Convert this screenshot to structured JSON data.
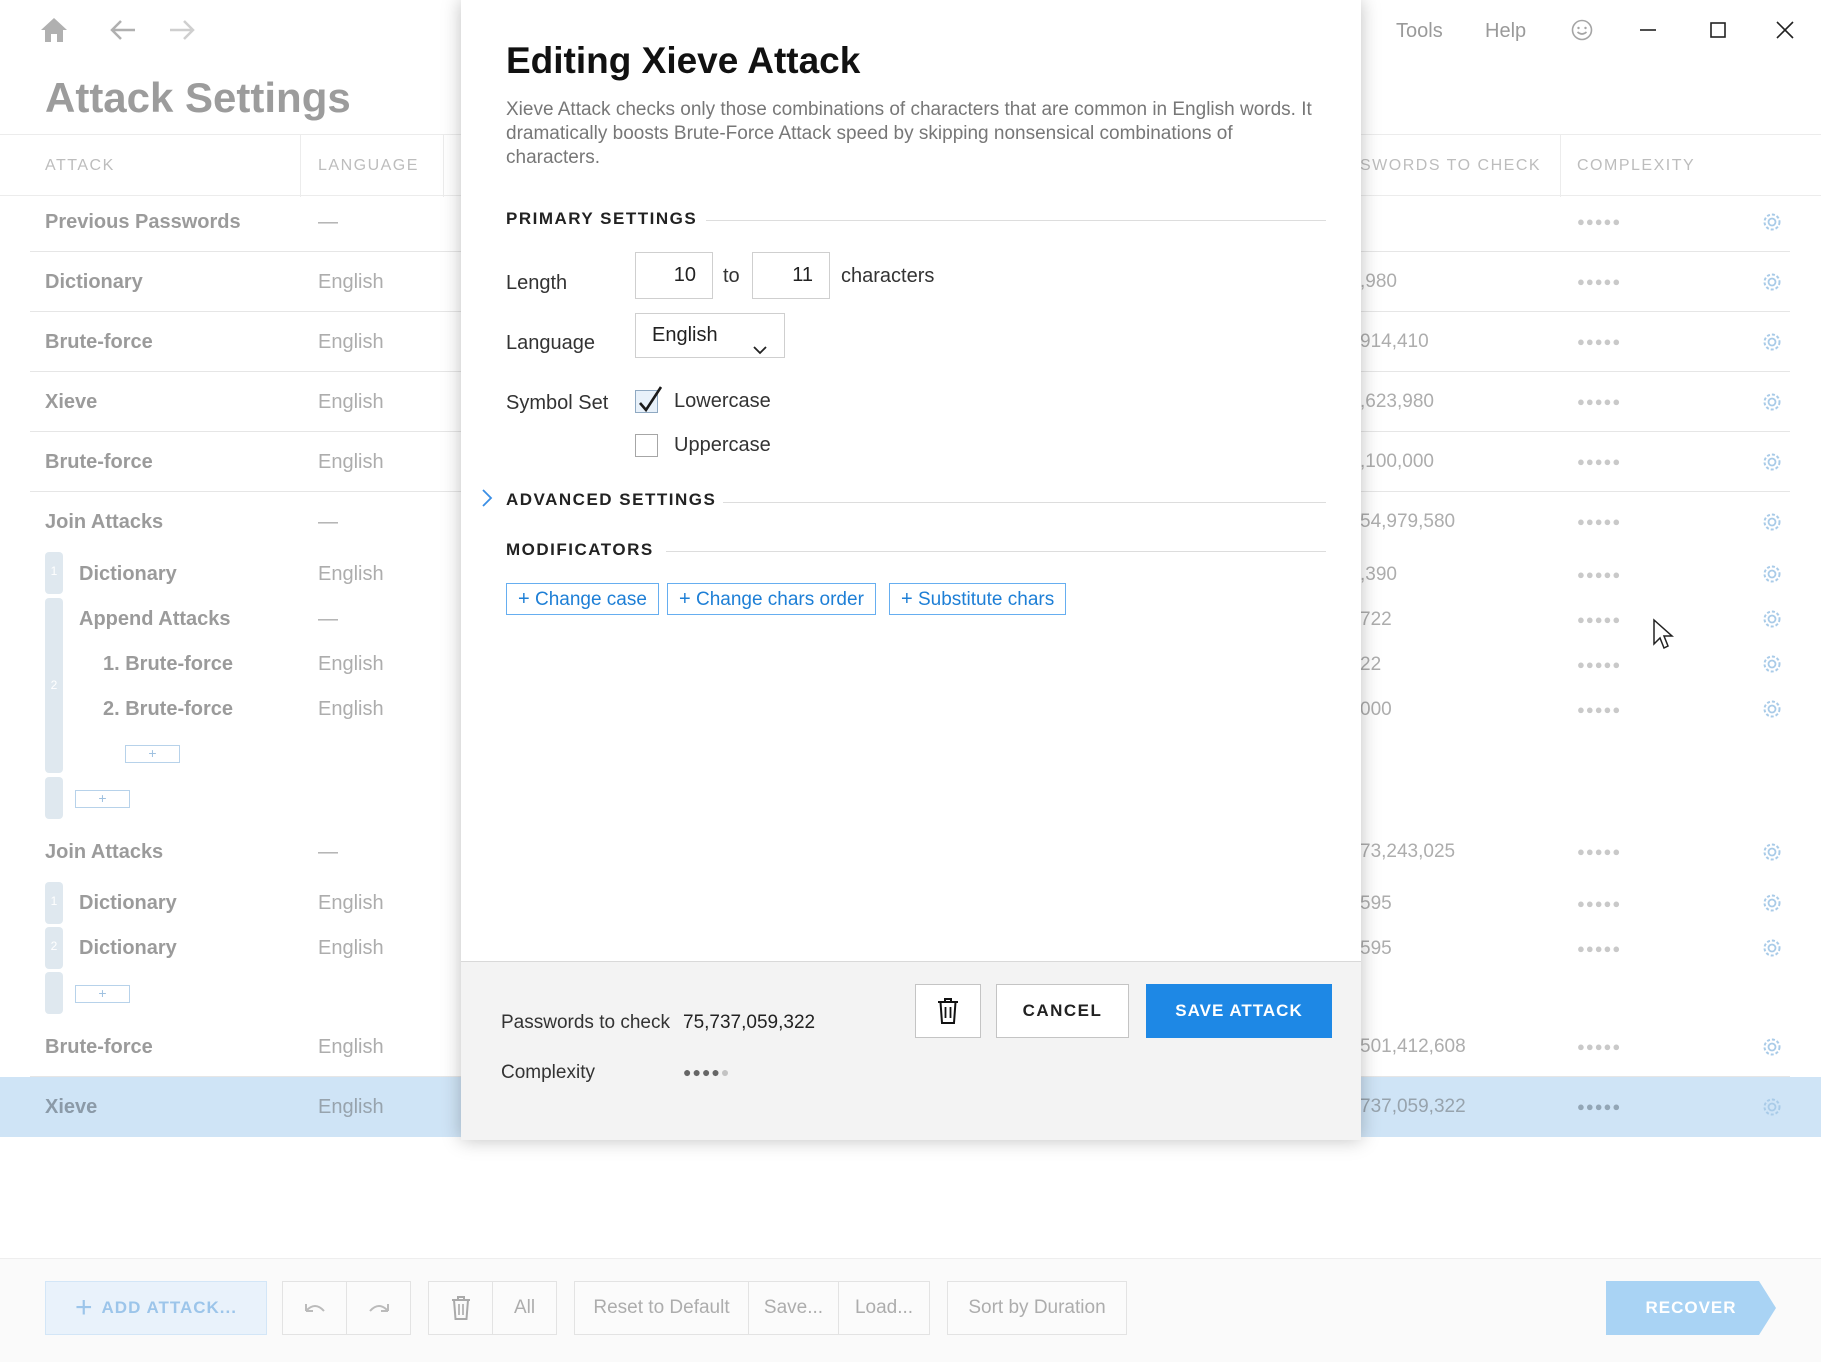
{
  "topbar": {
    "menu_tools": "Tools",
    "menu_help": "Help"
  },
  "page": {
    "title": "Attack Settings"
  },
  "table": {
    "headers": {
      "attack": "ATTACK",
      "language": "LANGUAGE",
      "passwords": "SWORDS TO CHECK",
      "complexity": "COMPLEXITY"
    },
    "rows": [
      {
        "name": "Previous Passwords",
        "lang": "—",
        "count": "",
        "dots": "●●●●●"
      },
      {
        "name": "Dictionary",
        "lang": "English",
        "count": ",980",
        "dots": "●●●●●"
      },
      {
        "name": "Brute-force",
        "lang": "English",
        "count": "914,410",
        "dots": "●●●●●"
      },
      {
        "name": "Xieve",
        "lang": "English",
        "count": ",623,980",
        "dots": "●●●●●"
      },
      {
        "name": "Brute-force",
        "lang": "English",
        "count": ",100,000",
        "dots": "●●●●●"
      },
      {
        "name": "Join Attacks",
        "lang": "—",
        "count": "54,979,580",
        "dots": "●●●●●"
      },
      {
        "name": "Dictionary",
        "lang": "English",
        "count": ",390",
        "dots": "●●●●●"
      },
      {
        "name": "Append Attacks",
        "lang": "—",
        "count": "722",
        "dots": "●●●●●"
      },
      {
        "name": "1. Brute-force",
        "lang": "English",
        "count": "22",
        "dots": "●●●●●"
      },
      {
        "name": "2. Brute-force",
        "lang": "English",
        "count": "000",
        "dots": "●●●●●"
      },
      {
        "name": "Join Attacks",
        "lang": "—",
        "count": "73,243,025",
        "dots": "●●●●●"
      },
      {
        "name": "Dictionary",
        "lang": "English",
        "count": "595",
        "dots": "●●●●●"
      },
      {
        "name": "Dictionary",
        "lang": "English",
        "count": "595",
        "dots": "●●●●●"
      },
      {
        "name": "Brute-force",
        "lang": "English",
        "count": "501,412,608",
        "dots": "●●●●●"
      },
      {
        "name": "Xieve",
        "lang": "English",
        "count": "737,059,322",
        "dots": "●●●●●"
      }
    ],
    "join_numbers": {
      "one": "1",
      "two": "2"
    },
    "plus": "+"
  },
  "bottombar": {
    "add_attack": "ADD ATTACK...",
    "all": "All",
    "reset": "Reset to Default",
    "save": "Save...",
    "load": "Load...",
    "sort": "Sort by Duration",
    "recover": "RECOVER"
  },
  "dialog": {
    "title": "Editing Xieve Attack",
    "description": "Xieve Attack checks only those combinations of characters that are common in English words. It dramatically boosts Brute-Force Attack speed by skipping nonsensical combinations of characters.",
    "primary_settings": "PRIMARY SETTINGS",
    "length_label": "Length",
    "length_from": "10",
    "length_to_word": "to",
    "length_to": "11",
    "length_unit": "characters",
    "language_label": "Language",
    "language_value": "English",
    "symbol_set_label": "Symbol Set",
    "lowercase_label": "Lowercase",
    "lowercase_checked": true,
    "uppercase_label": "Uppercase",
    "uppercase_checked": false,
    "advanced_settings": "ADVANCED SETTINGS",
    "modificators": "MODIFICATORS",
    "mod_change_case": "Change case",
    "mod_change_order": "Change chars order",
    "mod_substitute": "Substitute chars",
    "footer": {
      "passwords_label": "Passwords to check",
      "passwords_value": "75,737,059,322",
      "complexity_label": "Complexity",
      "complexity_level": 4,
      "complexity_max": 5,
      "cancel": "CANCEL",
      "save": "SAVE ATTACK"
    }
  },
  "colors": {
    "accent": "#1e88e5",
    "selected_row": "#cfe4f6"
  }
}
